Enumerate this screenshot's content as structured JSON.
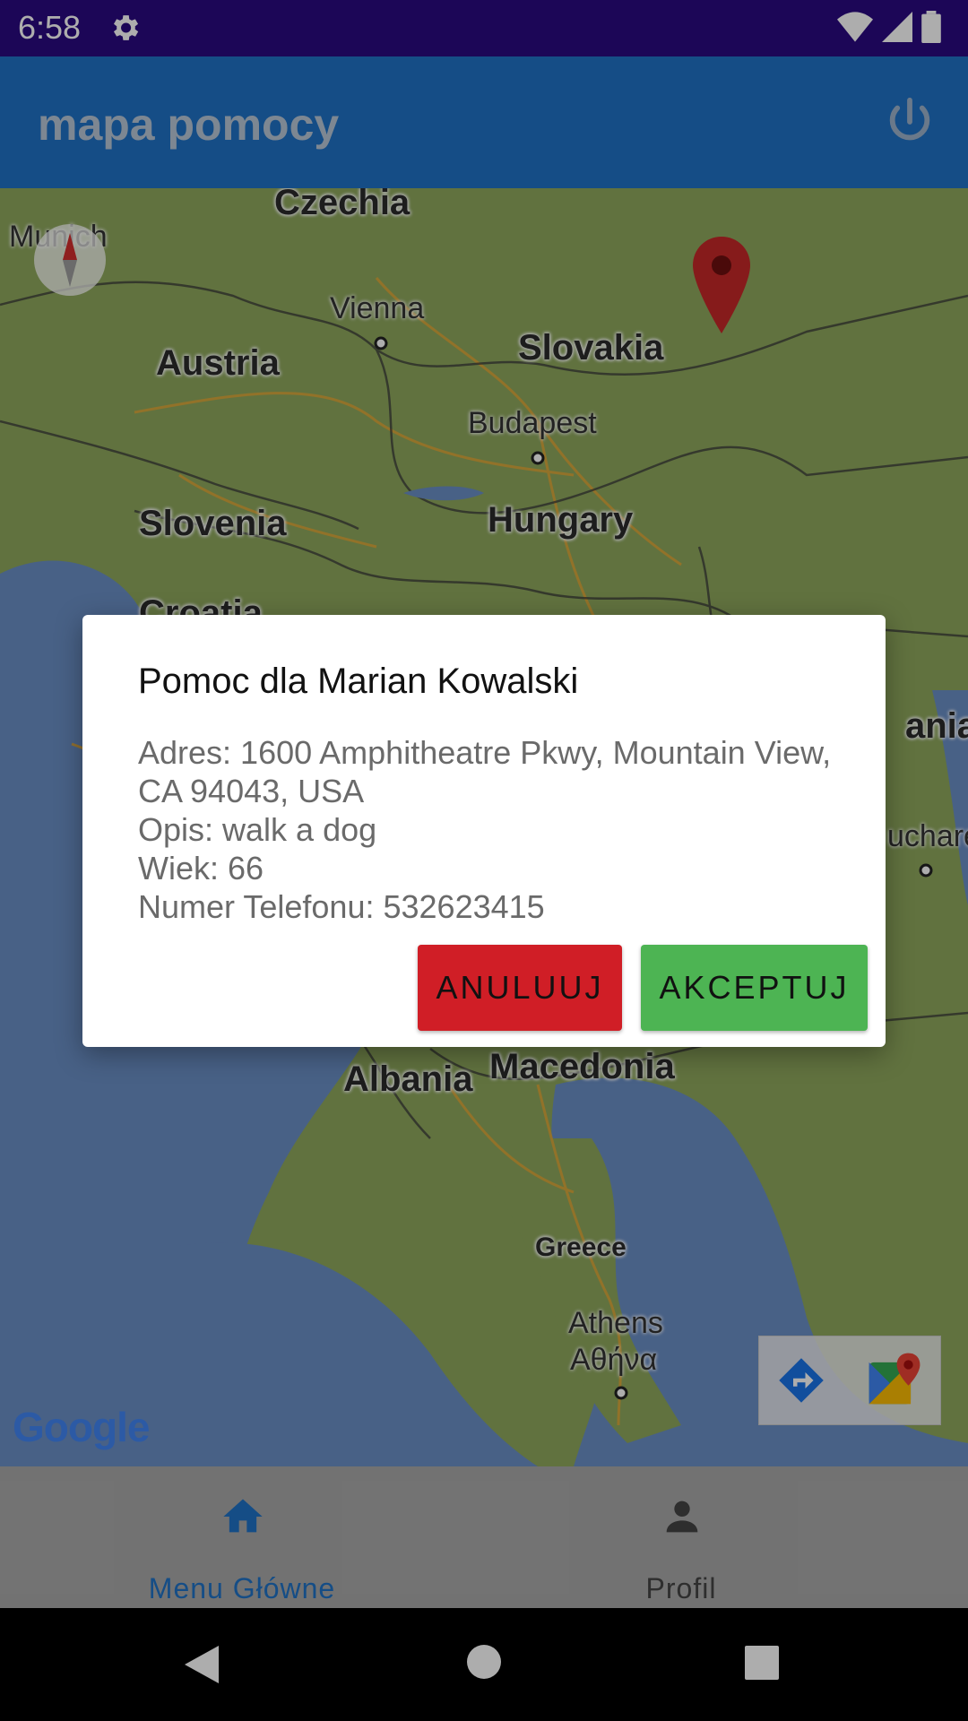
{
  "status_bar": {
    "time": "6:58"
  },
  "app_bar": {
    "title": "mapa pomocy"
  },
  "map": {
    "labels": {
      "czechia": "Czechia",
      "munich": "Munich",
      "vienna": "Vienna",
      "slovakia": "Slovakia",
      "austria": "Austria",
      "budapest": "Budapest",
      "slovenia": "Slovenia",
      "hungary": "Hungary",
      "croatia": "Croatia",
      "romania": "ania",
      "bucharest": "uchare",
      "albania": "Albania",
      "macedonia": "Macedonia",
      "greece": "Greece",
      "athens": "Athens",
      "athens_greek": "Αθήνα"
    },
    "google_logo": "Google"
  },
  "dialog": {
    "title": "Pomoc dla Marian Kowalski",
    "address": "Adres: 1600 Amphitheatre Pkwy, Mountain View, CA 94043, USA",
    "description": "Opis: walk a dog",
    "age": "Wiek: 66",
    "phone": "Numer Telefonu: 532623415",
    "cancel_label": "ANULUUJ",
    "accept_label": "AKCEPTUJ",
    "cancel_color": "#d01e26",
    "accept_color": "#4db453"
  },
  "bottom_nav": {
    "items": [
      {
        "label": "Menu Główne",
        "icon": "home-icon",
        "active": true
      },
      {
        "label": "Profil",
        "icon": "person-icon",
        "active": false
      }
    ],
    "active_color": "#1f72c6"
  }
}
